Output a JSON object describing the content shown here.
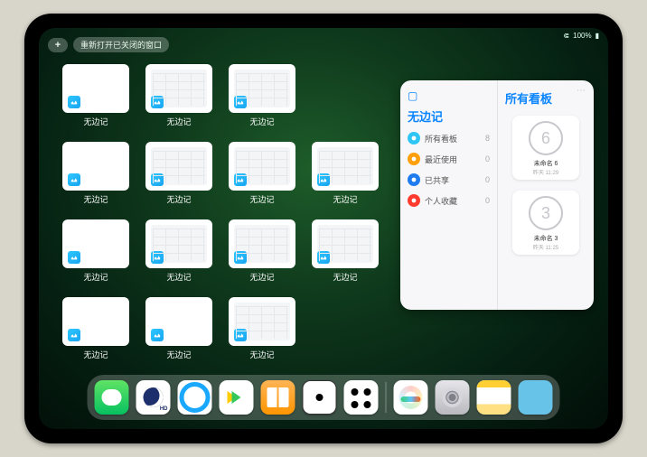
{
  "status": {
    "wifi": "wifi-icon",
    "battery": "100%"
  },
  "top": {
    "plus": "+",
    "reopen_label": "重新打开已关闭的窗口"
  },
  "tiles": [
    {
      "label": "无边记",
      "variant": "blank"
    },
    {
      "label": "无边记",
      "variant": "cal"
    },
    {
      "label": "无边记",
      "variant": "cal"
    },
    {
      "label": "无边记",
      "variant": "blank"
    },
    {
      "label": "无边记",
      "variant": "cal"
    },
    {
      "label": "无边记",
      "variant": "cal"
    },
    {
      "label": "无边记",
      "variant": "cal"
    },
    {
      "label": "无边记",
      "variant": "blank"
    },
    {
      "label": "无边记",
      "variant": "cal"
    },
    {
      "label": "无边记",
      "variant": "cal"
    },
    {
      "label": "无边记",
      "variant": "cal"
    },
    {
      "label": "无边记",
      "variant": "blank"
    },
    {
      "label": "无边记",
      "variant": "blank"
    },
    {
      "label": "无边记",
      "variant": "cal"
    }
  ],
  "grid_positions": [
    [
      1,
      1
    ],
    [
      1,
      2
    ],
    [
      1,
      3
    ],
    [
      2,
      1
    ],
    [
      2,
      2
    ],
    [
      2,
      3
    ],
    [
      2,
      4
    ],
    [
      3,
      1
    ],
    [
      3,
      2
    ],
    [
      3,
      3
    ],
    [
      3,
      4
    ],
    [
      4,
      1
    ],
    [
      4,
      2
    ],
    [
      4,
      3
    ]
  ],
  "panel": {
    "left_title": "无边记",
    "right_title": "所有看板",
    "rows": [
      {
        "icon_color": "#2fc6f6",
        "label": "所有看板",
        "count": 8
      },
      {
        "icon_color": "#ff9f0a",
        "label": "最近使用",
        "count": 0
      },
      {
        "icon_color": "#1e7bf0",
        "label": "已共享",
        "count": 0
      },
      {
        "icon_color": "#ff3b30",
        "label": "个人收藏",
        "count": 0
      }
    ],
    "boards": [
      {
        "glyph": "6",
        "name": "未命名 6",
        "date": "昨天 11:29"
      },
      {
        "glyph": "3",
        "name": "未命名 3",
        "date": "昨天 11:25"
      }
    ]
  },
  "dock": [
    {
      "name": "wechat-icon"
    },
    {
      "name": "browser-navy-icon"
    },
    {
      "name": "browser-blue-icon"
    },
    {
      "name": "play-store-icon"
    },
    {
      "name": "books-icon"
    },
    {
      "name": "dice-icon"
    },
    {
      "name": "dots-app-icon"
    },
    {
      "name": "freeform-icon"
    },
    {
      "name": "settings-icon"
    },
    {
      "name": "notes-icon"
    },
    {
      "name": "app-library-icon"
    }
  ]
}
